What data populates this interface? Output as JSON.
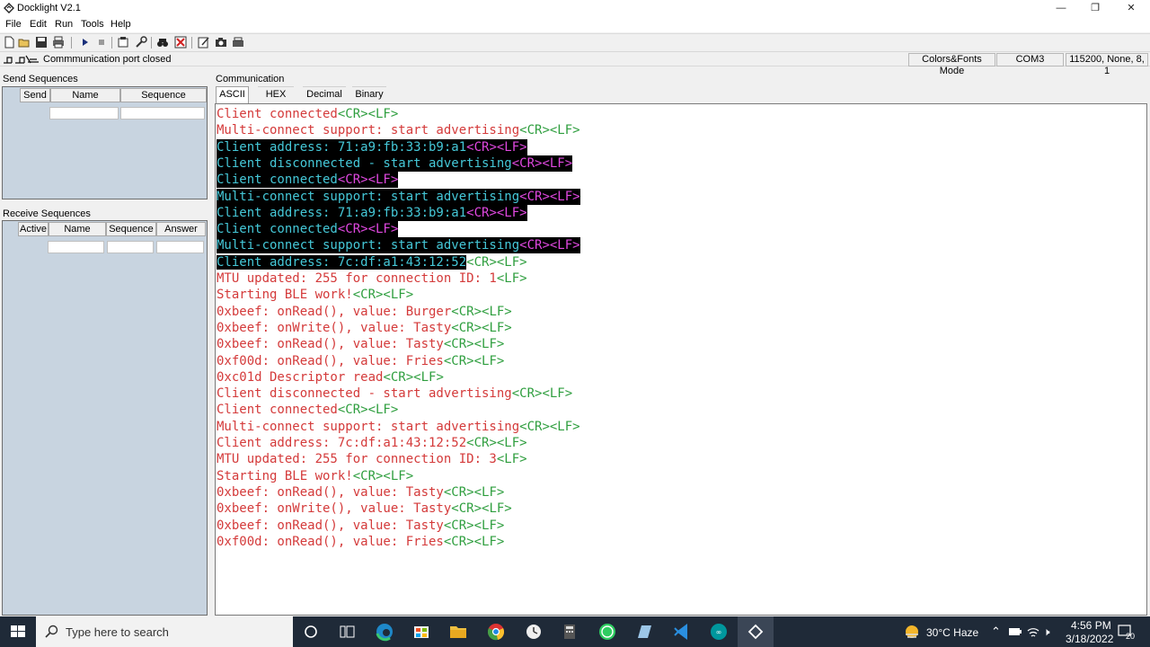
{
  "window": {
    "title": "Docklight V2.1",
    "controls": [
      "—",
      "❐",
      "✕"
    ]
  },
  "menu": [
    "File",
    "Edit",
    "Run",
    "Tools",
    "Help"
  ],
  "status": {
    "port_text": "Commmunication port closed",
    "mode": "Colors&Fonts Mode",
    "com": "COM3",
    "settings": "115200, None, 8, 1"
  },
  "send_sequences": {
    "label": "Send Sequences",
    "columns": [
      "Send",
      "Name",
      "Sequence"
    ]
  },
  "receive_sequences": {
    "label": "Receive Sequences",
    "columns": [
      "Active",
      "Name",
      "Sequence",
      "Answer"
    ]
  },
  "communication": {
    "label": "Communication",
    "tabs": [
      "ASCII",
      "HEX",
      "Decimal",
      "Binary"
    ],
    "active_tab": "ASCII",
    "lines": [
      {
        "t": "Client connected",
        "c": "<CR><LF>"
      },
      {
        "t": "Multi-connect support: start advertising",
        "c": "<CR><LF>"
      },
      {
        "t": "Client address: 71:a9:fb:33:b9:a1",
        "c": "<CR><LF>"
      },
      {
        "t": "Client disconnected - start advertising",
        "c": "<CR><LF>"
      },
      {
        "t": "Client connected",
        "c": "<CR><LF>"
      },
      {
        "t": "Multi-connect support: start advertising",
        "c": "<CR><LF>"
      },
      {
        "t": "Client address: 71:a9:fb:33:b9:a1",
        "c": "<CR><LF>"
      },
      {
        "t": "Client connected",
        "c": "<CR><LF>"
      },
      {
        "t": "Multi-connect support: start advertising",
        "c": "<CR><LF>"
      },
      {
        "t": "Client address: 7c:df:a1:43:12:52",
        "c": "<CR><LF>"
      },
      {
        "t": "MTU updated: 255 for connection ID: 1",
        "c": "<LF>"
      },
      {
        "t": "Starting BLE work!",
        "c": "<CR><LF>"
      },
      {
        "t": "0xbeef: onRead(), value: Burger",
        "c": "<CR><LF>"
      },
      {
        "t": "0xbeef: onWrite(), value: Tasty",
        "c": "<CR><LF>"
      },
      {
        "t": "0xbeef: onRead(), value: Tasty",
        "c": "<CR><LF>"
      },
      {
        "t": "0xf00d: onRead(), value: Fries",
        "c": "<CR><LF>"
      },
      {
        "t": "0xc01d Descriptor read",
        "c": "<CR><LF>"
      },
      {
        "t": "Client disconnected - start advertising",
        "c": "<CR><LF>"
      },
      {
        "t": "Client connected",
        "c": "<CR><LF>"
      },
      {
        "t": "Multi-connect support: start advertising",
        "c": "<CR><LF>"
      },
      {
        "t": "Client address: 7c:df:a1:43:12:52",
        "c": "<CR><LF>"
      },
      {
        "t": "MTU updated: 255 for connection ID: 3",
        "c": "<LF>"
      },
      {
        "t": "Starting BLE work!",
        "c": "<CR><LF>"
      },
      {
        "t": "0xbeef: onRead(), value: Tasty",
        "c": "<CR><LF>"
      },
      {
        "t": "0xbeef: onWrite(), value: Tasty",
        "c": "<CR><LF>"
      },
      {
        "t": "0xbeef: onRead(), value: Tasty",
        "c": "<CR><LF>"
      },
      {
        "t": "0xf00d: onRead(), value: Fries",
        "c": "<CR><LF>"
      }
    ]
  },
  "taskbar": {
    "search_placeholder": "Type here to search",
    "weather": "30°C  Haze",
    "time": "4:56 PM",
    "date": "3/18/2022",
    "notifications": "20"
  },
  "colors": {
    "text_normal": "#d43a3a",
    "control_chars": "#2e9e3e",
    "selected_text": "#45c8d8",
    "selected_control": "#e048e0",
    "panel_bg": "#c8d4e0",
    "taskbar_bg": "#1f2a38"
  }
}
